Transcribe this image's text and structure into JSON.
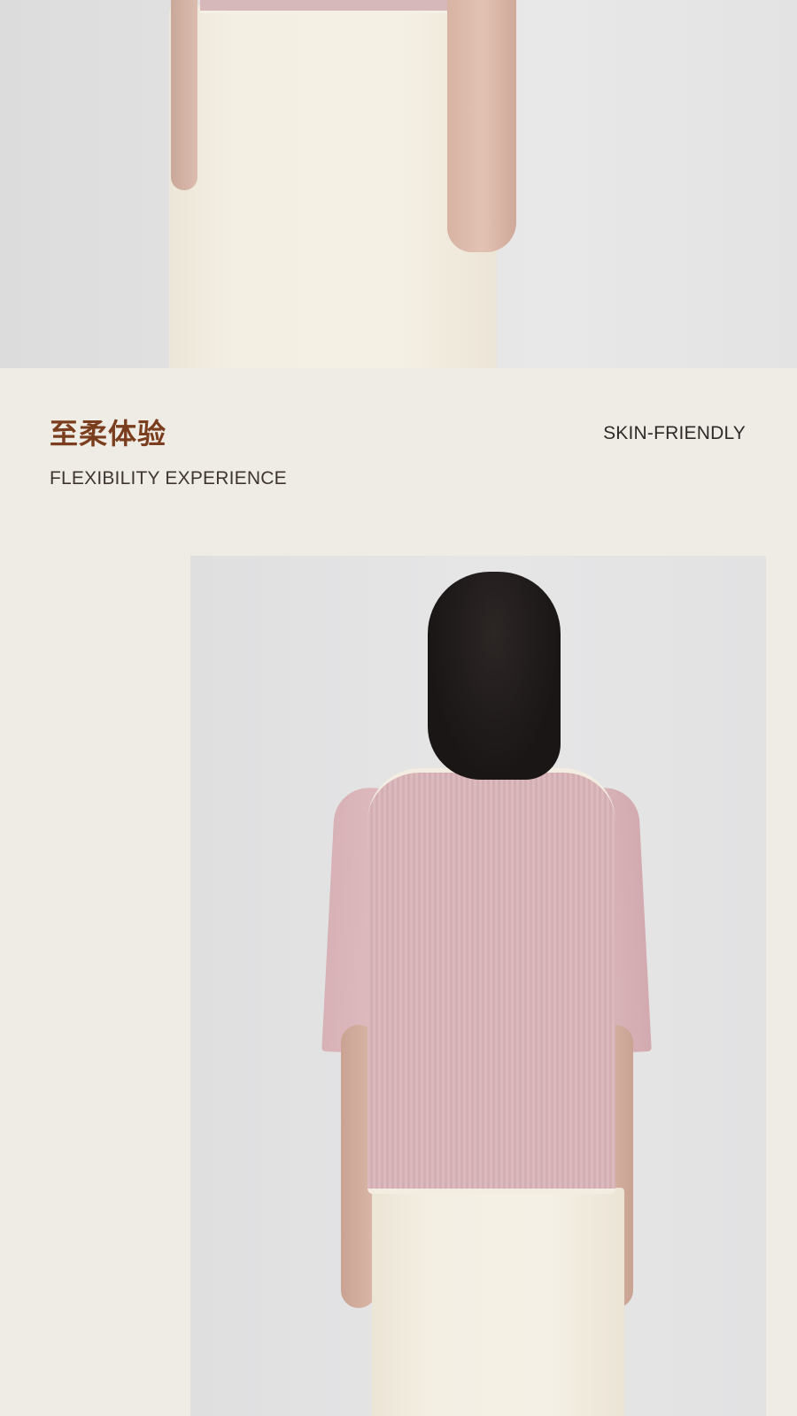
{
  "section": {
    "title_cn": "至柔体验",
    "title_en": "FLEXIBILITY EXPERIENCE",
    "tag": "SKIN-FRIENDLY"
  },
  "colors": {
    "page_background": "#efebe5",
    "title_cn": "#7a3d1d",
    "text_dark": "#2f2a28",
    "sweater_pink": "#d8b5b9",
    "skirt_cream": "#f4efe3"
  }
}
